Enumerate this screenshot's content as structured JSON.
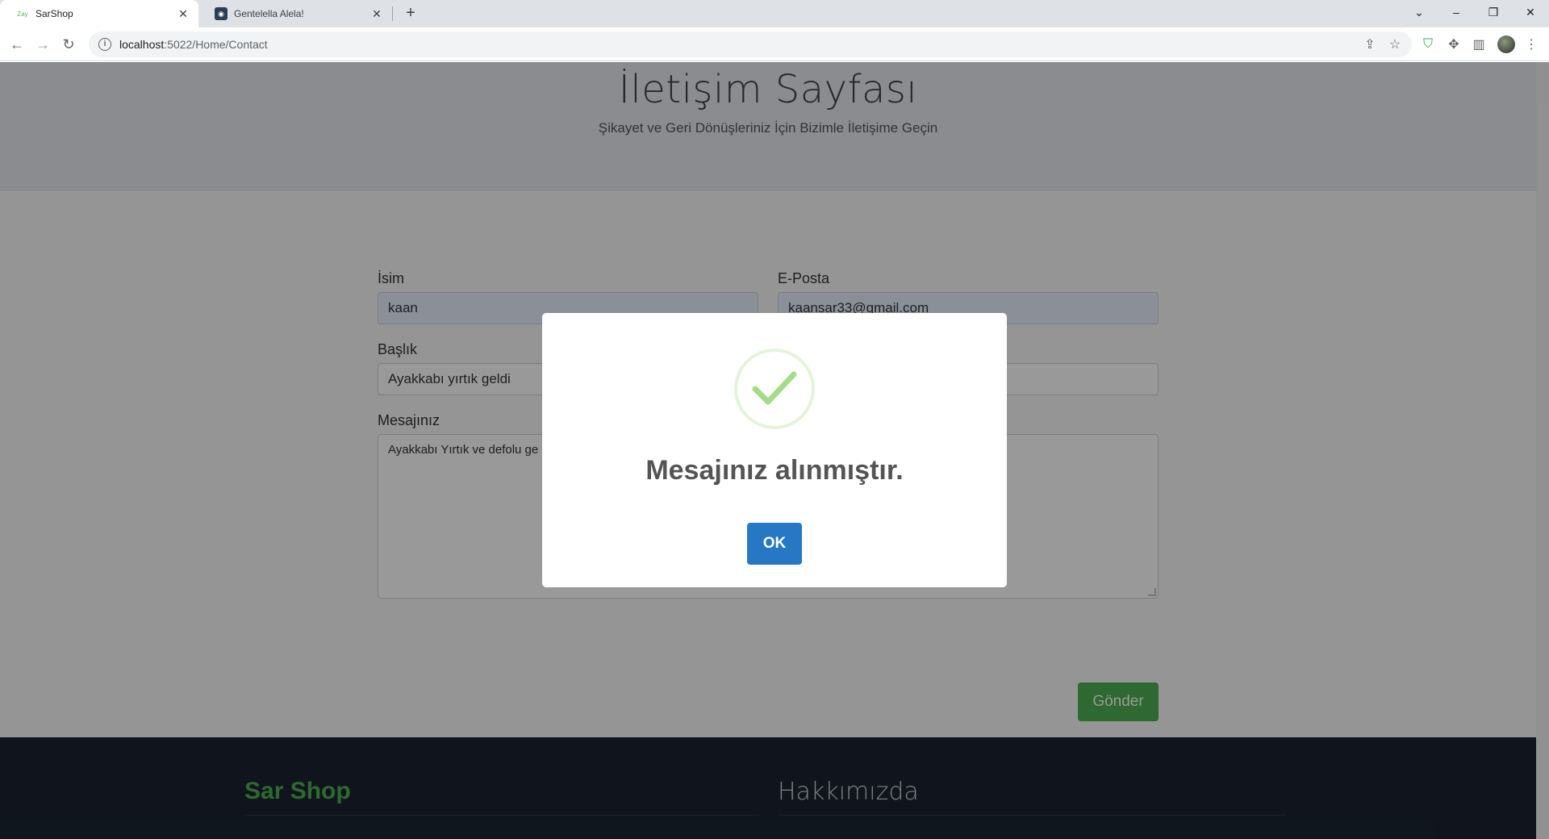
{
  "browser": {
    "tabs": [
      {
        "title": "SarShop",
        "favicon": "Zay"
      },
      {
        "title": "Gentelella Alela!"
      }
    ],
    "url_host": "localhost",
    "url_path": ":5022/Home/Contact"
  },
  "hero": {
    "title": "İletişim Sayfası",
    "subtitle": "Şikayet ve Geri Dönüşleriniz İçin Bizimle İletişime Geçin"
  },
  "form": {
    "name_label": "İsim",
    "name_value": "kaan",
    "email_label": "E-Posta",
    "email_value": "kaansar33@gmail.com",
    "subject_label": "Başlık",
    "subject_value": "Ayakkabı yırtık geldi",
    "message_label": "Mesajınız",
    "message_value": "Ayakkabı Yırtık ve defolu ge",
    "submit_label": "Gönder"
  },
  "footer": {
    "brand": "Sar Shop",
    "about": "Hakkımızda"
  },
  "modal": {
    "icon": "success-check-icon",
    "title": "Mesajınız alınmıştır.",
    "ok_label": "OK"
  }
}
